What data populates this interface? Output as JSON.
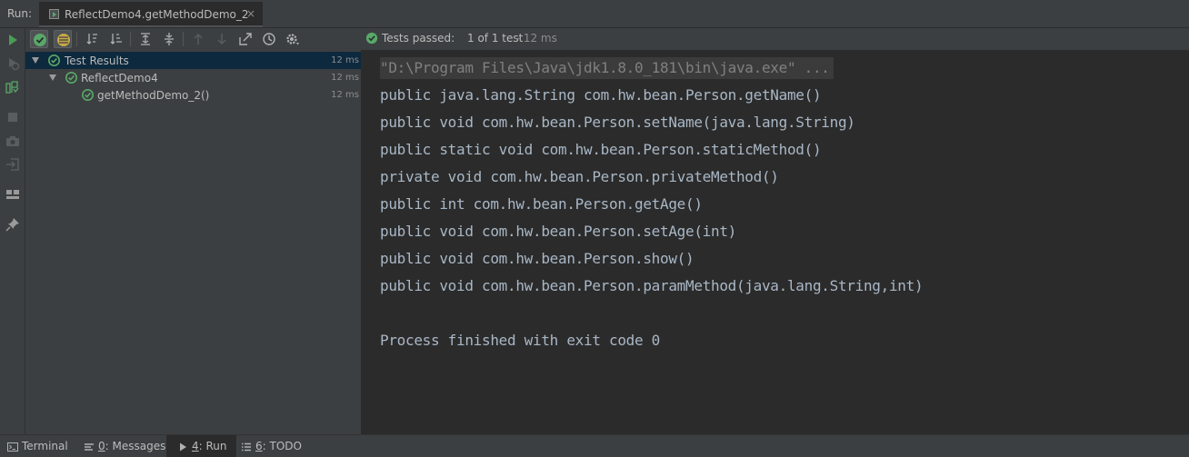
{
  "run_panel": {
    "label": "Run:",
    "tab": {
      "title": "ReflectDemo4.getMethodDemo_2",
      "close": "×"
    }
  },
  "toolbar": {
    "status_main": "Tests passed:",
    "status_count": "1 of 1 test",
    "status_time": "– 12 ms"
  },
  "tree": {
    "rows": [
      {
        "label": "Test Results",
        "duration": "12 ms"
      },
      {
        "label": "ReflectDemo4",
        "duration": "12 ms"
      },
      {
        "label": "getMethodDemo_2()",
        "duration": "12 ms"
      }
    ]
  },
  "console": {
    "lines": [
      "\"D:\\Program Files\\Java\\jdk1.8.0_181\\bin\\java.exe\" ...",
      "public java.lang.String com.hw.bean.Person.getName()",
      "public void com.hw.bean.Person.setName(java.lang.String)",
      "public static void com.hw.bean.Person.staticMethod()",
      "private void com.hw.bean.Person.privateMethod()",
      "public int com.hw.bean.Person.getAge()",
      "public void com.hw.bean.Person.setAge(int)",
      "public void com.hw.bean.Person.show()",
      "public void com.hw.bean.Person.paramMethod(java.lang.String,int)",
      "",
      "Process finished with exit code 0"
    ]
  },
  "bottom_bar": {
    "terminal": "Terminal",
    "messages_key": "0",
    "messages": ": Messages",
    "run_key": "4",
    "run": ": Run",
    "todo_key": "6",
    "todo": ": TODO"
  },
  "icons": {
    "run": "play-icon",
    "rerun_failed": "rerun-failed-icon",
    "toggle_autotest": "toggle-auto-test-icon",
    "stop": "stop-icon",
    "snapshot": "camera-icon",
    "exit": "exit-icon",
    "layout": "layout-icon",
    "pin": "pin-icon"
  },
  "colors": {
    "success": "#59a869",
    "selection": "#0d293e",
    "console_bg": "#2b2b2b",
    "panel_bg": "#3c3f41"
  }
}
